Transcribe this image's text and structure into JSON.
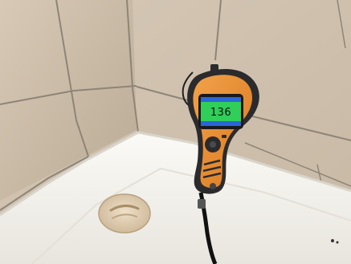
{
  "photo": {
    "subject": "moisture-meter",
    "meter": {
      "reading": "136",
      "body_color": "#e98a2a",
      "casing_color": "#2b2b2d",
      "screen_color": "#2fcf5a"
    },
    "environment": {
      "tile_color": "#cbbca8",
      "grout_color": "#8e8577",
      "tub_color": "#f2f0ea"
    }
  }
}
